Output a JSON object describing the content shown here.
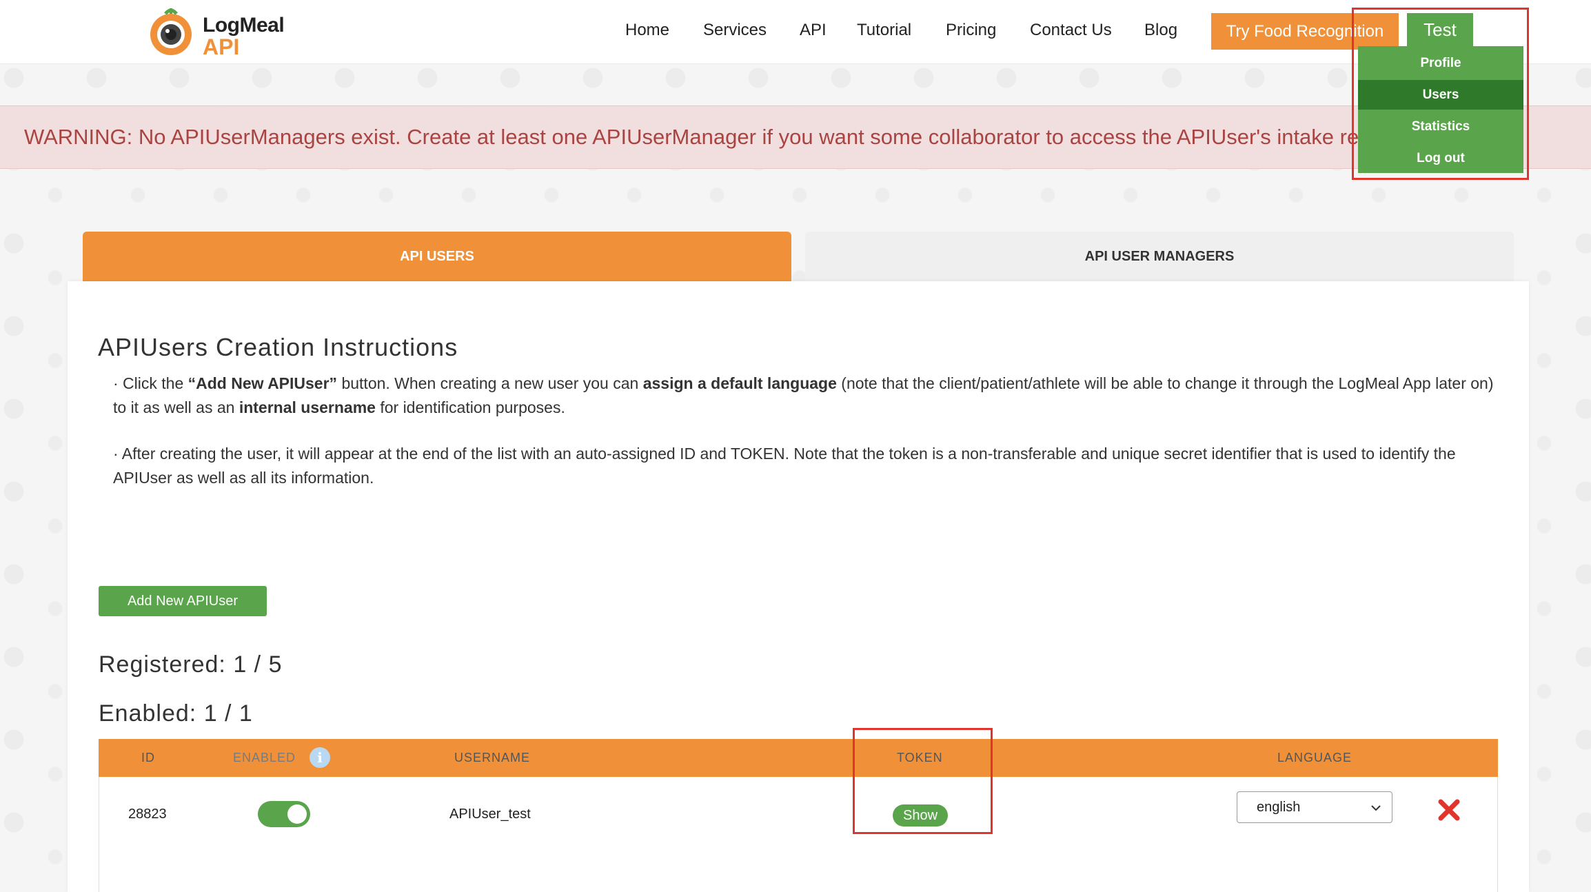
{
  "header": {
    "logo_top": "LogMeal",
    "logo_bottom": "API",
    "nav": [
      "Home",
      "Services",
      "API",
      "Tutorial",
      "Pricing",
      "Contact Us",
      "Blog"
    ],
    "try_button": "Try Food Recognition",
    "user_button": "Test"
  },
  "user_menu": {
    "items": [
      "Profile",
      "Users",
      "Statistics",
      "Log out"
    ],
    "active": "Users"
  },
  "warning": "WARNING: No APIUserManagers exist. Create at least one APIUserManager if you want some collaborator to access the APIUser's intake remotely.",
  "tabs": {
    "api_users": "API USERS",
    "api_user_managers": "API USER MANAGERS"
  },
  "instructions": {
    "title": "APIUsers Creation Instructions",
    "p1_a": "· Click the ",
    "p1_b": "“Add New APIUser”",
    "p1_c": " button. When creating a new user you can ",
    "p1_d": "assign a default language",
    "p1_e": " (note that the client/patient/athlete will be able to change it through the LogMeal App later on) to it as well as an ",
    "p1_f": "internal username",
    "p1_g": " for identification purposes.",
    "p2": "· After creating the user, it will appear at the end of the list with an auto-assigned ID and TOKEN. Note that the token is a non-transferable and unique secret identifier that is used to identify the APIUser as well as all its information."
  },
  "add_button": "Add New APIUser",
  "stats": {
    "registered_label": "Registered:",
    "registered_value": "1 / 5",
    "enabled_label": "Enabled:",
    "enabled_value": "1 / 1"
  },
  "table": {
    "headers": {
      "id": "ID",
      "enabled": "ENABLED",
      "username": "USERNAME",
      "token": "TOKEN",
      "language": "LANGUAGE"
    },
    "rows": [
      {
        "id": "28823",
        "enabled": true,
        "username": "APIUser_test",
        "token_button": "Show",
        "language": "english"
      }
    ]
  },
  "colors": {
    "orange": "#f0913a",
    "green": "#5aa54b",
    "green_dark": "#2f7a2a",
    "warning_text": "#a94442",
    "warning_bg": "#f1dede",
    "highlight_red": "#e0342c"
  }
}
